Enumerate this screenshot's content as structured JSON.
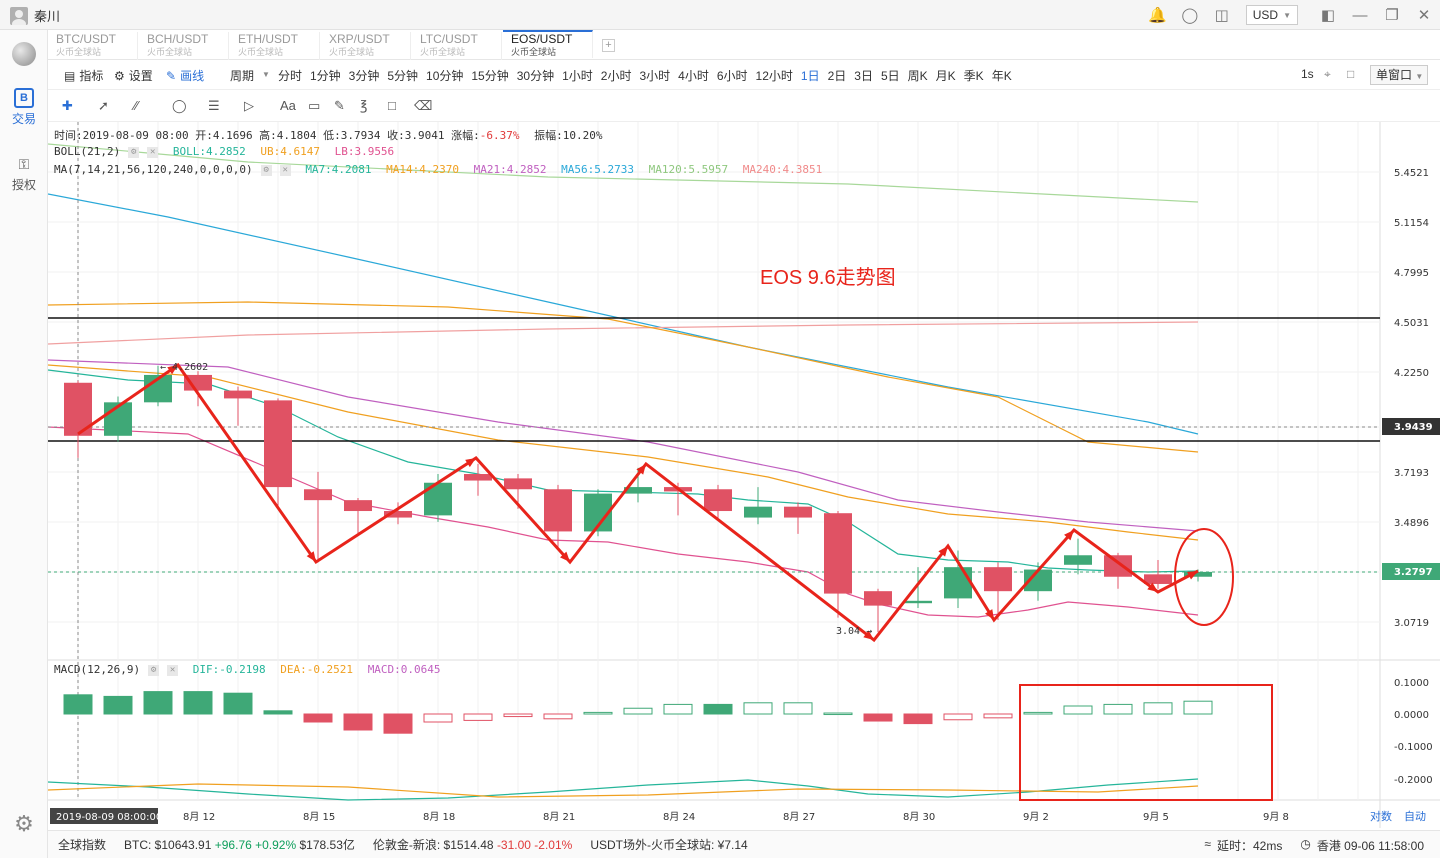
{
  "titlebar": {
    "user_name": "秦川",
    "currency": "USD",
    "icons": [
      "bell-icon",
      "chat-icon",
      "shirt-icon",
      "layout-icon",
      "minimize-icon",
      "restore-icon",
      "close-icon"
    ]
  },
  "sidebar": {
    "items": [
      {
        "label": "交易",
        "icon": "B",
        "active": true
      },
      {
        "label": "授权",
        "icon": "key-icon",
        "active": false
      }
    ]
  },
  "tabs": [
    {
      "name": "BTC/USDT",
      "sub": "火币全球站",
      "active": false
    },
    {
      "name": "BCH/USDT",
      "sub": "火币全球站",
      "active": false
    },
    {
      "name": "ETH/USDT",
      "sub": "火币全球站",
      "active": false
    },
    {
      "name": "XRP/USDT",
      "sub": "火币全球站",
      "active": false
    },
    {
      "name": "LTC/USDT",
      "sub": "火币全球站",
      "active": false
    },
    {
      "name": "EOS/USDT",
      "sub": "火币全球站",
      "active": true
    }
  ],
  "toolbar": {
    "indicator": "指标",
    "settings": "设置",
    "draw": "画线",
    "period_label": "周期",
    "periods": [
      "分时",
      "1分钟",
      "3分钟",
      "5分钟",
      "10分钟",
      "15分钟",
      "30分钟",
      "1小时",
      "2小时",
      "3小时",
      "4小时",
      "6小时",
      "12小时",
      "1日",
      "2日",
      "3日",
      "5日",
      "周K",
      "月K",
      "季K",
      "年K"
    ],
    "active_period": "1日",
    "interval": "1s",
    "window_mode": "单窗口"
  },
  "info": {
    "ohlc": "时间:2019-08-09 08:00  开:4.1696  高:4.1804  低:3.7934  收:3.9041  涨幅:",
    "change": "-6.37%",
    "amplitude": "振幅:10.20%",
    "boll_name": "BOLL(21,2)",
    "boll": "BOLL:4.2852",
    "ub": "UB:4.6147",
    "lb": "LB:3.9556",
    "ma_name": "MA(7,14,21,56,120,240,0,0,0,0)",
    "ma7": "MA7:4.2081",
    "ma14": "MA14:4.2370",
    "ma21": "MA21:4.2852",
    "ma56": "MA56:5.2733",
    "ma120": "MA120:5.5957",
    "ma240": "MA240:4.3851",
    "macd_name": "MACD(12,26,9)",
    "dif": "DIF:-0.2198",
    "dea": "DEA:-0.2521",
    "macd": "MACD:0.0645"
  },
  "annotation": {
    "title": "EOS  9.6走势图",
    "high_label": "4.2602",
    "low_label": "3.04"
  },
  "price_axis": [
    "5.4521",
    "5.1154",
    "4.7995",
    "4.5031",
    "4.2250",
    "3.7193",
    "3.4896",
    "3.0719"
  ],
  "price_current": "3.2797",
  "price_crosshair": "3.9439",
  "macd_axis": [
    "0.1000",
    "0.0000",
    "-0.1000",
    "-0.2000"
  ],
  "date_axis": [
    "8月 12",
    "8月 15",
    "8月 18",
    "8月 21",
    "8月 24",
    "8月 27",
    "8月 30",
    "9月 2",
    "9月 5",
    "9月 8"
  ],
  "date_crosshair": "2019-08-09 08:00:00",
  "axis_modes": {
    "log": "对数",
    "auto": "自动"
  },
  "chart_data": {
    "type": "candlestick",
    "candles": [
      {
        "o": 4.17,
        "h": 4.18,
        "l": 3.79,
        "c": 3.9
      },
      {
        "o": 3.9,
        "h": 4.1,
        "l": 3.87,
        "c": 4.07
      },
      {
        "o": 4.07,
        "h": 4.26,
        "l": 4.05,
        "c": 4.21
      },
      {
        "o": 4.21,
        "h": 4.23,
        "l": 4.05,
        "c": 4.13
      },
      {
        "o": 4.13,
        "h": 4.15,
        "l": 3.95,
        "c": 4.09
      },
      {
        "o": 4.08,
        "h": 4.09,
        "l": 3.55,
        "c": 3.65
      },
      {
        "o": 3.64,
        "h": 3.72,
        "l": 3.32,
        "c": 3.59
      },
      {
        "o": 3.59,
        "h": 3.6,
        "l": 3.44,
        "c": 3.54
      },
      {
        "o": 3.54,
        "h": 3.58,
        "l": 3.48,
        "c": 3.51
      },
      {
        "o": 3.52,
        "h": 3.71,
        "l": 3.49,
        "c": 3.67
      },
      {
        "o": 3.71,
        "h": 3.76,
        "l": 3.61,
        "c": 3.68
      },
      {
        "o": 3.69,
        "h": 3.71,
        "l": 3.55,
        "c": 3.64
      },
      {
        "o": 3.64,
        "h": 3.66,
        "l": 3.37,
        "c": 3.45
      },
      {
        "o": 3.45,
        "h": 3.64,
        "l": 3.43,
        "c": 3.62
      },
      {
        "o": 3.62,
        "h": 3.74,
        "l": 3.58,
        "c": 3.65
      },
      {
        "o": 3.65,
        "h": 3.67,
        "l": 3.52,
        "c": 3.63
      },
      {
        "o": 3.64,
        "h": 3.66,
        "l": 3.5,
        "c": 3.54
      },
      {
        "o": 3.51,
        "h": 3.65,
        "l": 3.48,
        "c": 3.56
      },
      {
        "o": 3.56,
        "h": 3.58,
        "l": 3.44,
        "c": 3.51
      },
      {
        "o": 3.53,
        "h": 3.54,
        "l": 3.09,
        "c": 3.19
      },
      {
        "o": 3.2,
        "h": 3.21,
        "l": 3.03,
        "c": 3.14
      },
      {
        "o": 3.15,
        "h": 3.3,
        "l": 3.13,
        "c": 3.16
      },
      {
        "o": 3.17,
        "h": 3.37,
        "l": 3.13,
        "c": 3.3
      },
      {
        "o": 3.3,
        "h": 3.32,
        "l": 3.08,
        "c": 3.2
      },
      {
        "o": 3.2,
        "h": 3.32,
        "l": 3.16,
        "c": 3.29
      },
      {
        "o": 3.31,
        "h": 3.42,
        "l": 3.27,
        "c": 3.35
      },
      {
        "o": 3.35,
        "h": 3.36,
        "l": 3.21,
        "c": 3.26
      },
      {
        "o": 3.27,
        "h": 3.33,
        "l": 3.21,
        "c": 3.23
      },
      {
        "o": 3.26,
        "h": 3.29,
        "l": 3.24,
        "c": 3.28
      }
    ],
    "macd_hist": [
      0.06,
      0.055,
      0.07,
      0.07,
      0.065,
      0.01,
      -0.025,
      -0.05,
      -0.06,
      -0.025,
      -0.02,
      -0.008,
      -0.015,
      0.005,
      0.018,
      0.03,
      0.03,
      0.035,
      0.035,
      0.003,
      -0.022,
      -0.03,
      -0.018,
      -0.012,
      0.005,
      0.025,
      0.03,
      0.035,
      0.04
    ],
    "y_range": [
      3.0,
      5.5
    ],
    "macd_range": [
      -0.26,
      0.11
    ],
    "colors": {
      "up": "#3fa877",
      "down": "#e05264",
      "ma7": "#25b59a",
      "ma14": "#f0a020",
      "ma21": "#c060c0",
      "ma56": "#2aa8d8",
      "ma120": "#a8d89a",
      "ma240": "#f0a0a0",
      "arrow": "#e8241b"
    }
  }
}
